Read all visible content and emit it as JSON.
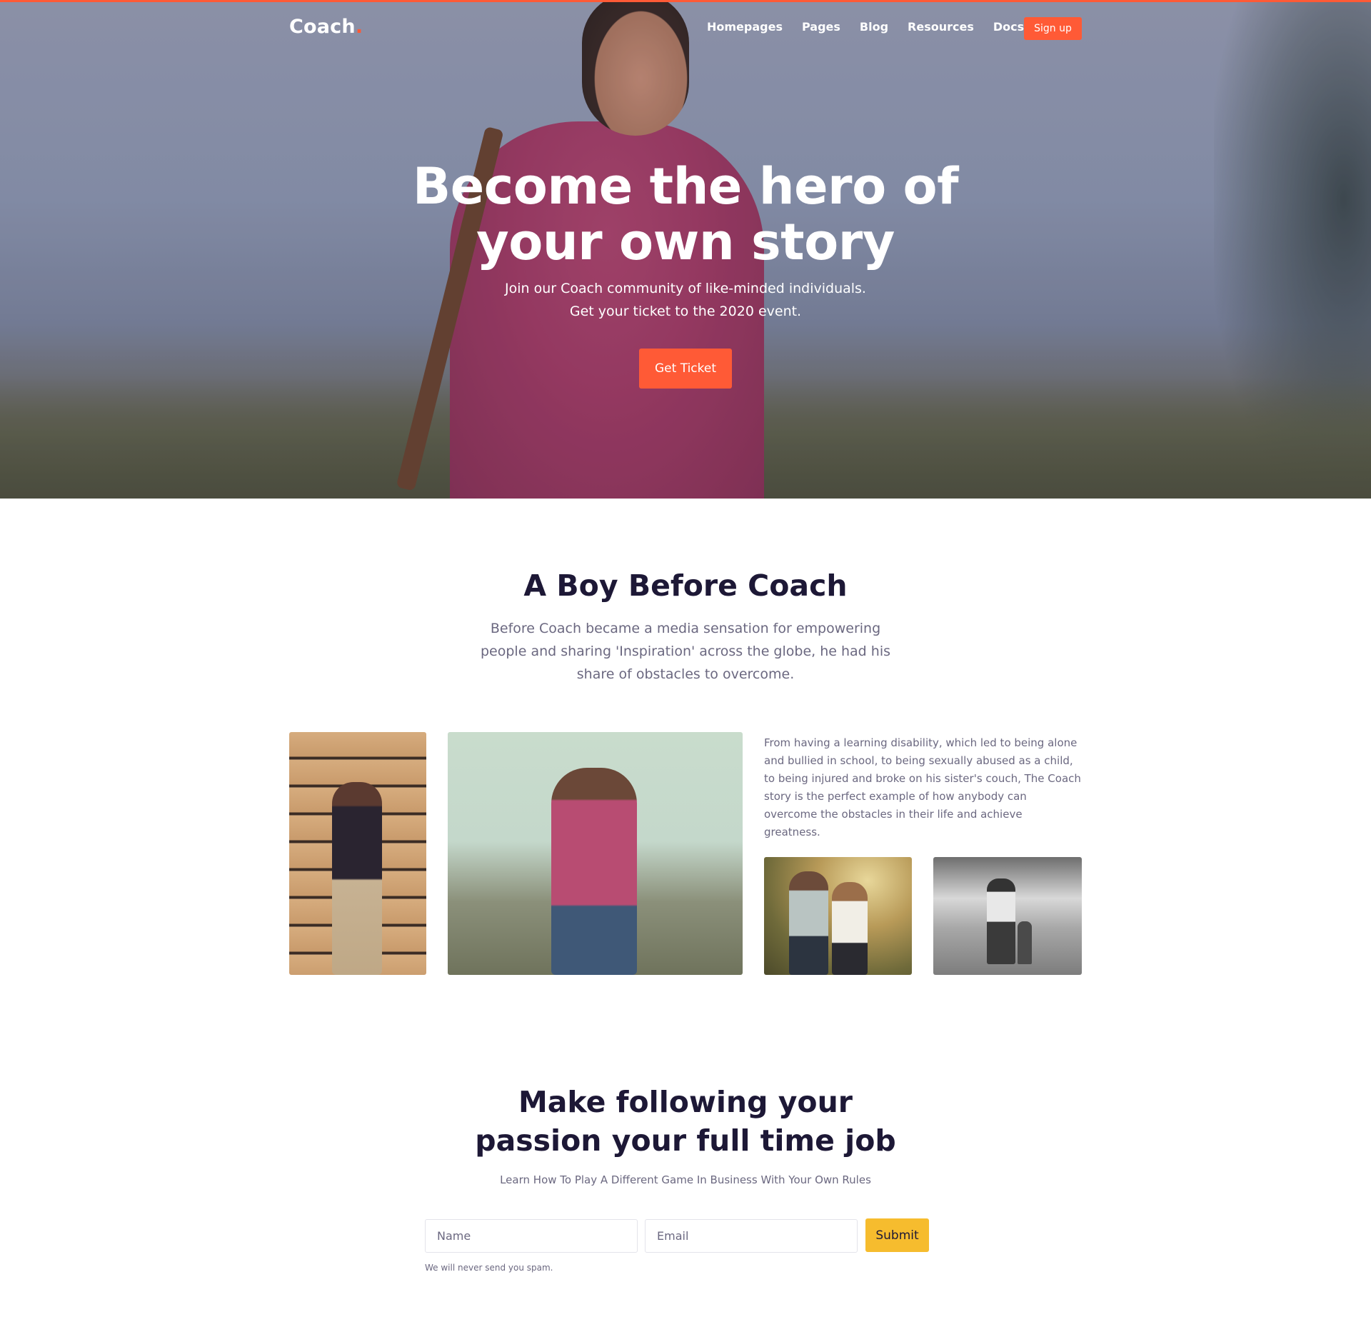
{
  "colors": {
    "accent": "#ff5a36",
    "submit": "#f6bc2e",
    "heading": "#1d1836",
    "body_text": "#6b6880"
  },
  "nav": {
    "logo_text": "Coach",
    "logo_dot": ".",
    "links": [
      "Homepages",
      "Pages",
      "Blog",
      "Resources",
      "Docs"
    ],
    "signup_label": "Sign up"
  },
  "hero": {
    "title": "Become the hero of your own story",
    "subtitle_line1": "Join our Coach community of like-minded individuals.",
    "subtitle_line2": "Get your ticket to the 2020 event.",
    "cta_label": "Get Ticket"
  },
  "about": {
    "title": "A Boy Before Coach",
    "lead": "Before Coach became a media sensation for empowering people and sharing 'Inspiration' across the globe, he had his share of obstacles to overcome.",
    "body": "From having a learning disability, which led to being alone and bullied in school, to being sexually abused as a child, to being injured and broke on his sister's couch, The Coach story is the perfect example of how anybody can overcome the obstacles in their life and achieve greatness.",
    "images": [
      {
        "alt": "man-with-book-against-wood-wall"
      },
      {
        "alt": "man-walking-with-shoulder-bag"
      },
      {
        "alt": "couple-in-park"
      },
      {
        "alt": "father-and-child-walking-on-road"
      }
    ]
  },
  "signup_form": {
    "title_line1": "Make following your",
    "title_line2": "passion your full time job",
    "subtitle": "Learn How To Play A Different Game In Business With Your Own Rules",
    "name_placeholder": "Name",
    "email_placeholder": "Email",
    "submit_label": "Submit",
    "note": "We will never send you spam."
  }
}
